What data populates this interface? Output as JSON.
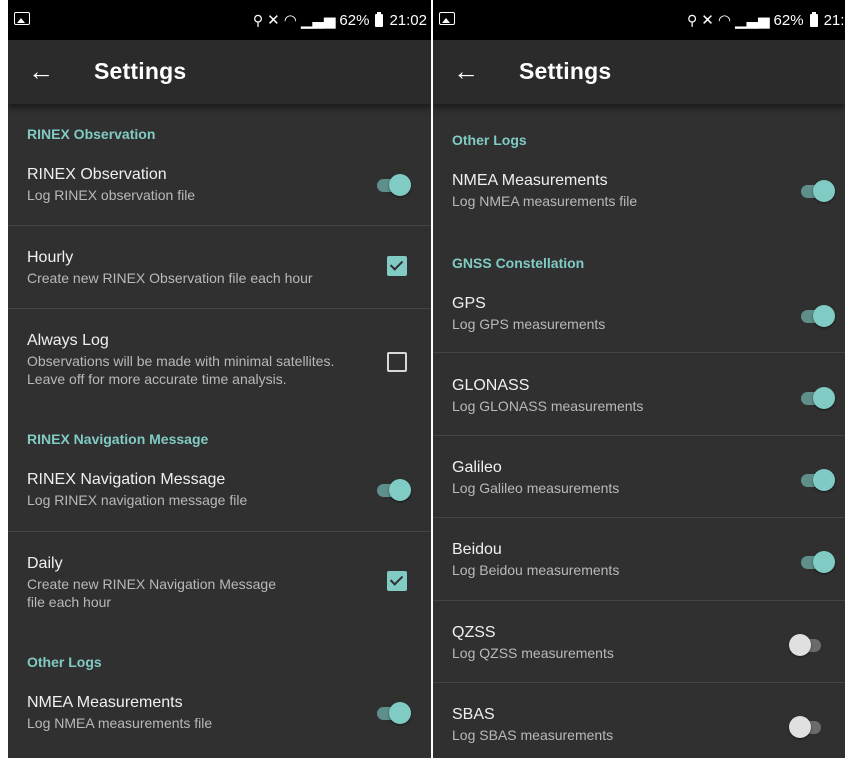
{
  "accent_color": "#80cbc4",
  "status_bar": {
    "left_icon": "gallery-icon",
    "battery_percent": "62%",
    "time_left": "21:02",
    "time_right": "21:0"
  },
  "screens": {
    "left": {
      "title": "Settings",
      "sections": {
        "rinex_obs_header": "RINEX Observation",
        "rinex_nav_header": "RINEX Navigation Message",
        "other_logs_header": "Other Logs"
      },
      "items": {
        "rinex_observation": {
          "title": "RINEX Observation",
          "summary": "Log RINEX observation file",
          "state": "on"
        },
        "hourly": {
          "title": "Hourly",
          "summary": "Create new RINEX Observation file each hour",
          "state": "checked"
        },
        "always_log": {
          "title": "Always Log",
          "summary_line1": "Observations will be made with minimal satellites.",
          "summary_line2": "Leave off for more accurate time analysis.",
          "state": "unchecked"
        },
        "rinex_nav": {
          "title": "RINEX Navigation Message",
          "summary": "Log RINEX navigation message file",
          "state": "on"
        },
        "daily": {
          "title": "Daily",
          "summary_line1": "Create new RINEX Navigation Message",
          "summary_line2": "file each hour",
          "state": "checked"
        },
        "nmea": {
          "title": "NMEA Measurements",
          "summary": "Log NMEA measurements file",
          "state": "on"
        }
      }
    },
    "right": {
      "title": "Settings",
      "sections": {
        "other_logs_header": "Other Logs",
        "gnss_header": "GNSS Constellation"
      },
      "items": {
        "nmea": {
          "title": "NMEA Measurements",
          "summary": "Log NMEA measurements file",
          "state": "on"
        },
        "gps": {
          "title": "GPS",
          "summary": "Log GPS measurements",
          "state": "on"
        },
        "glonass": {
          "title": "GLONASS",
          "summary": "Log GLONASS measurements",
          "state": "on"
        },
        "galileo": {
          "title": "Galileo",
          "summary": "Log Galileo measurements",
          "state": "on"
        },
        "beidou": {
          "title": "Beidou",
          "summary": "Log Beidou measurements",
          "state": "on"
        },
        "qzss": {
          "title": "QZSS",
          "summary": "Log QZSS measurements",
          "state": "off"
        },
        "sbas": {
          "title": "SBAS",
          "summary": "Log SBAS measurements",
          "state": "off"
        }
      }
    }
  }
}
